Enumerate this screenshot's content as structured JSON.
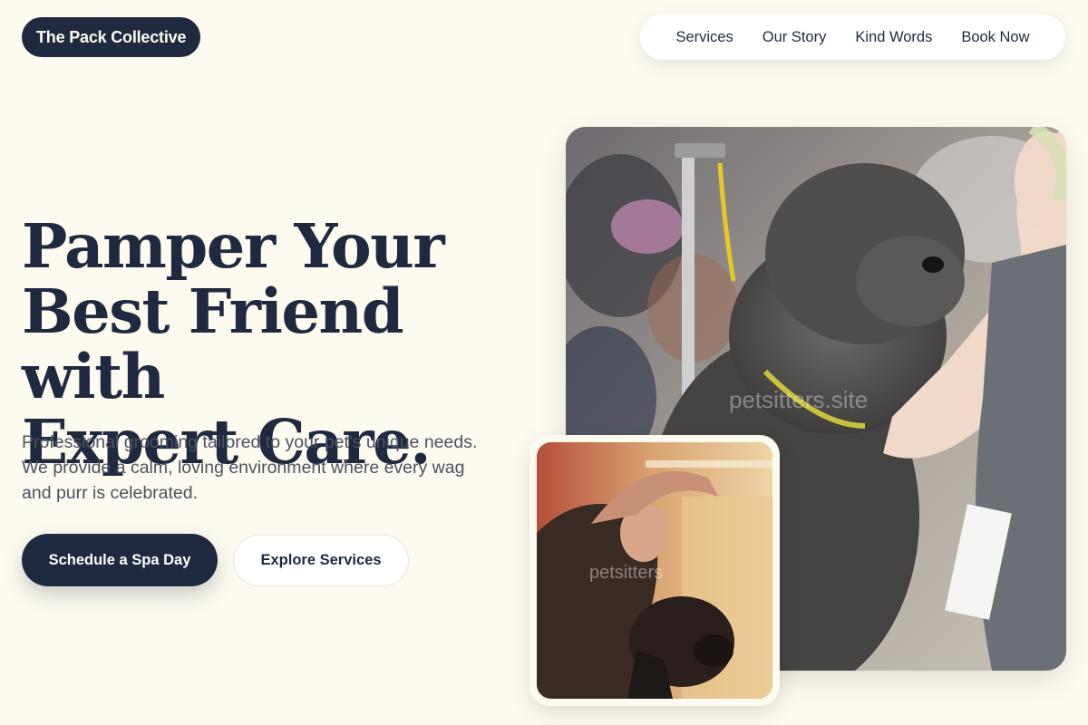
{
  "brand": {
    "name": "The Pack Collective"
  },
  "nav": {
    "items": [
      {
        "label": "Services"
      },
      {
        "label": "Our Story"
      },
      {
        "label": "Kind Words"
      },
      {
        "label": "Book Now"
      }
    ]
  },
  "hero": {
    "headline_line1": "Pamper Your",
    "headline_line2": "Best Friend with",
    "headline_line3": "Expert Care.",
    "subtext": "Professional grooming tailored to your pet's unique needs. We provide a calm, loving environment where every wag and purr is celebrated.",
    "primary_cta": "Schedule a Spa Day",
    "secondary_cta": "Explore Services"
  },
  "images": {
    "main_watermark": "petsitters.site",
    "small_watermark": "petsitters"
  },
  "colors": {
    "background": "#fdfbef",
    "navy": "#1f2a40",
    "body_text": "#4b5363"
  }
}
